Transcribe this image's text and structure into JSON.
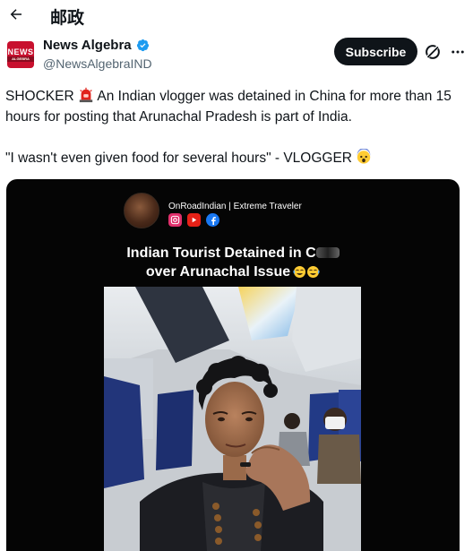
{
  "topbar": {
    "back_icon": "arrow-left-icon",
    "title": "邮政"
  },
  "post": {
    "author": {
      "display_name": "News Algebra",
      "handle": "@NewsAlgebraIND",
      "avatar_text_top": "NEWS",
      "avatar_text_bottom": "ALGEBRA",
      "verified": true,
      "verified_color": "#1d9bf0"
    },
    "subscribe_label": "Subscribe",
    "grok_icon": "grok-icon",
    "more_icon": "more-icon",
    "text_line1_before": "SHOCKER ",
    "text_line1_emoji": "police-light-emoji",
    "text_line1_after": " An Indian vlogger was detained in China for more than 15 hours for posting that Arunachal Pradesh is part of India.",
    "text_line2": "\"I wasn't even given food for several hours\" - VLOGGER ",
    "text_line2_emoji": "shocked-face-emoji"
  },
  "media": {
    "creator_label": "OnRoadIndian | Extreme Traveler",
    "socials": [
      "instagram-icon",
      "youtube-icon",
      "facebook-icon"
    ],
    "title_line1": "Indian Tourist Detained in C",
    "title_line2": "over Arunachal Issue",
    "title_emoji": "laughing-emoji"
  },
  "colors": {
    "text": "#0f1419",
    "secondary": "#536471",
    "button_bg": "#0f1419",
    "media_bg": "#050505"
  }
}
